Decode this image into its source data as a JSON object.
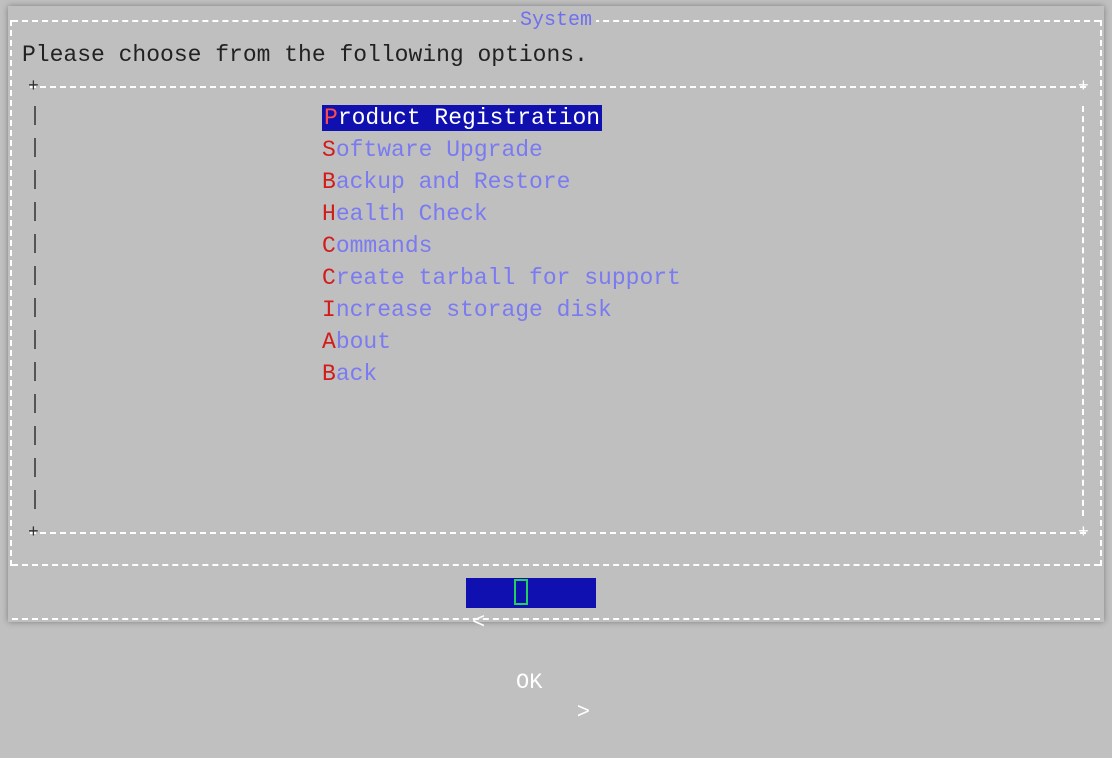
{
  "dialog": {
    "title": "System",
    "prompt": "Please choose from the following options."
  },
  "menu": {
    "items": [
      {
        "hotkey": "P",
        "rest": "roduct Registration",
        "selected": true
      },
      {
        "hotkey": "S",
        "rest": "oftware Upgrade"
      },
      {
        "hotkey": "B",
        "rest": "ackup and Restore"
      },
      {
        "hotkey": "H",
        "rest": "ealth Check"
      },
      {
        "hotkey": "C",
        "rest": "ommands"
      },
      {
        "hotkey": "C",
        "rest": "reate tarball for support"
      },
      {
        "hotkey": "I",
        "rest": "ncrease storage disk"
      },
      {
        "hotkey": "A",
        "rest": "bout"
      },
      {
        "hotkey": "B",
        "rest": "ack"
      }
    ]
  },
  "buttons": {
    "ok_label": "OK",
    "left_bracket": "<",
    "right_bracket": ">"
  },
  "colors": {
    "background": "#bfbfbf",
    "menu_text": "#7a7af2",
    "hotkey": "#d21c1c",
    "selection_bg": "#1010b0",
    "cursor": "#21d060"
  }
}
